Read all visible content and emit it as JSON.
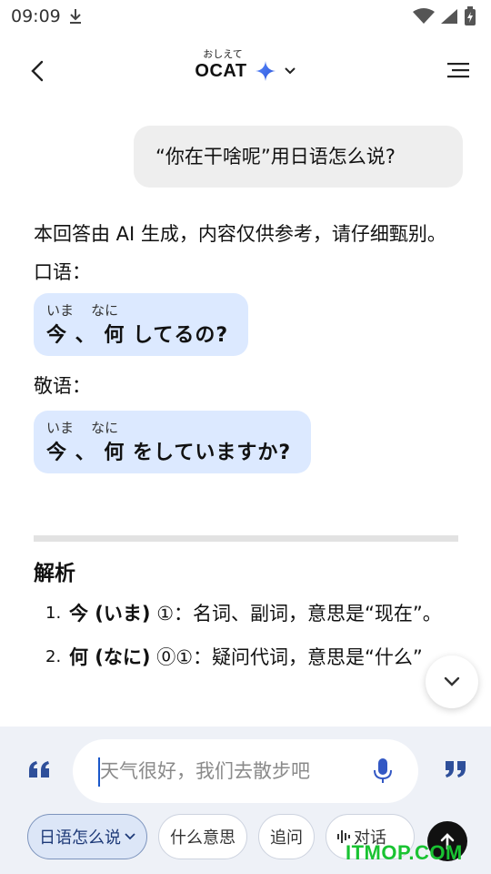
{
  "status_bar": {
    "time": "09:09"
  },
  "header": {
    "title": "OCAT",
    "title_ruby": "おしえて"
  },
  "chat": {
    "user_message": "“你在干啥呢”用日语怎么说?",
    "ai_intro": "本回答由 AI 生成，内容仅供参考，请仔细甄别。",
    "colloquial_label": "口语：",
    "colloquial": {
      "ruby": "いま    なに",
      "text": "今 、 何 してるの?"
    },
    "polite_label": "敬语：",
    "polite": {
      "ruby": "いま    なに",
      "text": "今 、 何 をしていますか?"
    },
    "analysis_title": "解析",
    "analysis_items": [
      {
        "num": "1.",
        "term": "今 (いま)",
        "desc": " ①：名词、副词，意思是“现在”。"
      },
      {
        "num": "2.",
        "term": "何 (なに)",
        "desc": " ⓪①：疑问代词，意思是“什么”"
      }
    ]
  },
  "input": {
    "placeholder": "天气很好，我们去散步吧"
  },
  "chips": [
    {
      "label": "日语怎么说",
      "active": true
    },
    {
      "label": "什么意思",
      "active": false
    },
    {
      "label": "追问",
      "active": false
    },
    {
      "label": "对话",
      "active": false
    }
  ],
  "watermark": "ITMOP.COM",
  "colors": {
    "accent": "#1a57c9",
    "bubble_blue": "#dce9ff",
    "watermark_green": "#19c332"
  }
}
